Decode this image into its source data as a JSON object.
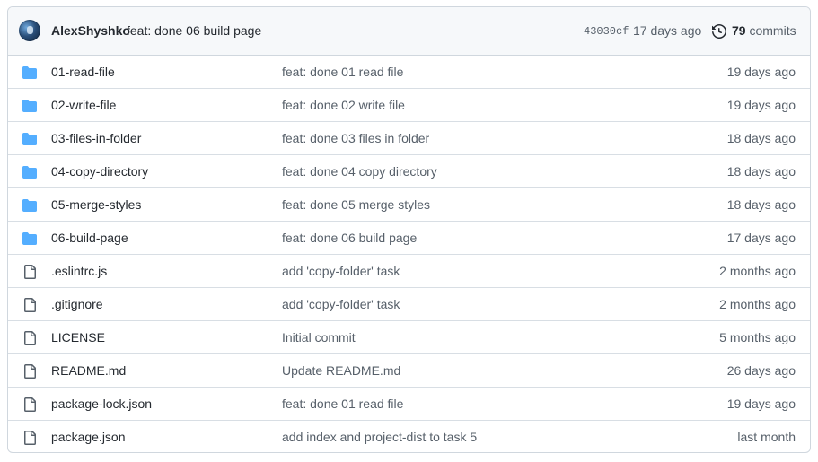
{
  "latest_commit": {
    "author": "AlexShyshko",
    "message": "feat: done 06 build page",
    "sha": "43030cf",
    "time_ago": "17 days ago",
    "commits_count": "79",
    "commits_label": "commits"
  },
  "colors": {
    "folder": "#54aeff",
    "file": "#57606a",
    "border": "#d0d7de",
    "header_bg": "#f6f8fa"
  },
  "files": [
    {
      "type": "folder",
      "icon": "folder-icon",
      "name": "01-read-file",
      "message": "feat: done 01 read file",
      "time": "19 days ago"
    },
    {
      "type": "folder",
      "icon": "folder-icon",
      "name": "02-write-file",
      "message": "feat: done 02 write file",
      "time": "19 days ago"
    },
    {
      "type": "folder",
      "icon": "folder-icon",
      "name": "03-files-in-folder",
      "message": "feat: done 03 files in folder",
      "time": "18 days ago"
    },
    {
      "type": "folder",
      "icon": "folder-icon",
      "name": "04-copy-directory",
      "message": "feat: done 04 copy directory",
      "time": "18 days ago"
    },
    {
      "type": "folder",
      "icon": "folder-icon",
      "name": "05-merge-styles",
      "message": "feat: done 05 merge styles",
      "time": "18 days ago"
    },
    {
      "type": "folder",
      "icon": "folder-icon",
      "name": "06-build-page",
      "message": "feat: done 06 build page",
      "time": "17 days ago"
    },
    {
      "type": "file",
      "icon": "file-icon",
      "name": ".eslintrc.js",
      "message": "add 'copy-folder' task",
      "time": "2 months ago"
    },
    {
      "type": "file",
      "icon": "file-icon",
      "name": ".gitignore",
      "message": "add 'copy-folder' task",
      "time": "2 months ago"
    },
    {
      "type": "file",
      "icon": "file-icon",
      "name": "LICENSE",
      "message": "Initial commit",
      "time": "5 months ago"
    },
    {
      "type": "file",
      "icon": "file-icon",
      "name": "README.md",
      "message": "Update README.md",
      "time": "26 days ago"
    },
    {
      "type": "file",
      "icon": "file-icon",
      "name": "package-lock.json",
      "message": "feat: done 01 read file",
      "time": "19 days ago"
    },
    {
      "type": "file",
      "icon": "file-icon",
      "name": "package.json",
      "message": "add index and project-dist to task 5",
      "time": "last month"
    }
  ]
}
